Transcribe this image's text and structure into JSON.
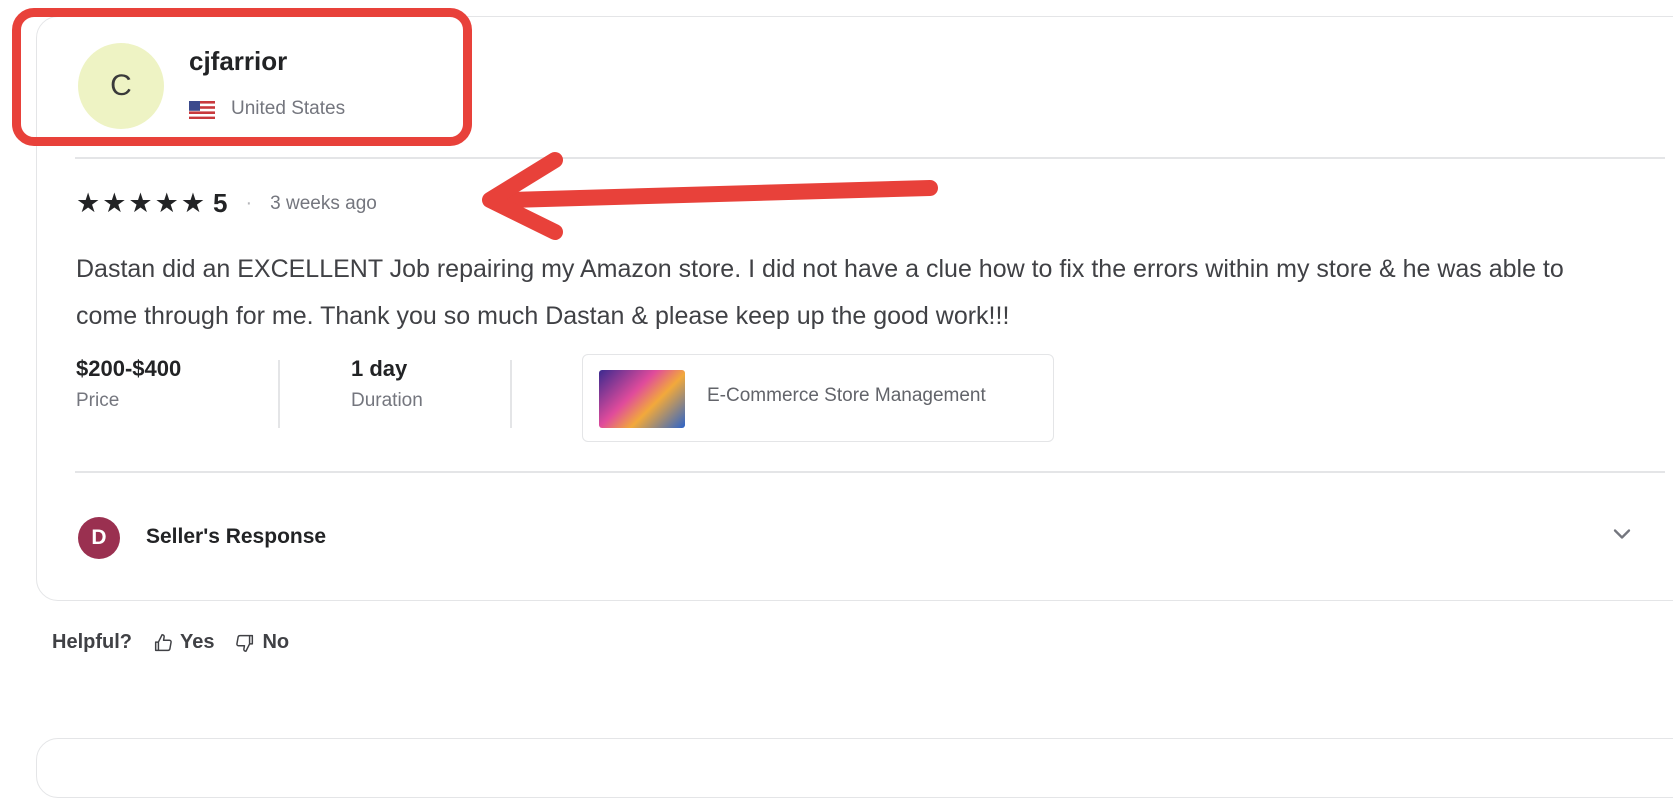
{
  "reviewer": {
    "avatar_initial": "C",
    "username": "cjfarrior",
    "country": "United States",
    "flag_icon": "us-flag-icon"
  },
  "rating": {
    "stars_display": "★★★★★",
    "score": "5",
    "separator": "·",
    "time_ago": "3 weeks ago"
  },
  "review_text": "Dastan did an EXCELLENT Job repairing my Amazon store. I did not have a clue how to fix the errors within my store & he was able to come through for me. Thank you so much Dastan & please keep up the good work!!!",
  "meta": {
    "price_value": "$200-$400",
    "price_label": "Price",
    "duration_value": "1 day",
    "duration_label": "Duration"
  },
  "gig": {
    "title": "E-Commerce Store Management"
  },
  "seller_response": {
    "avatar_initial": "D",
    "label": "Seller's Response"
  },
  "helpful": {
    "question": "Helpful?",
    "yes_label": "Yes",
    "no_label": "No"
  },
  "colors": {
    "annotation_red": "#e8413a",
    "seller_avatar": "#9a3050",
    "reviewer_avatar": "#eef3c4"
  }
}
